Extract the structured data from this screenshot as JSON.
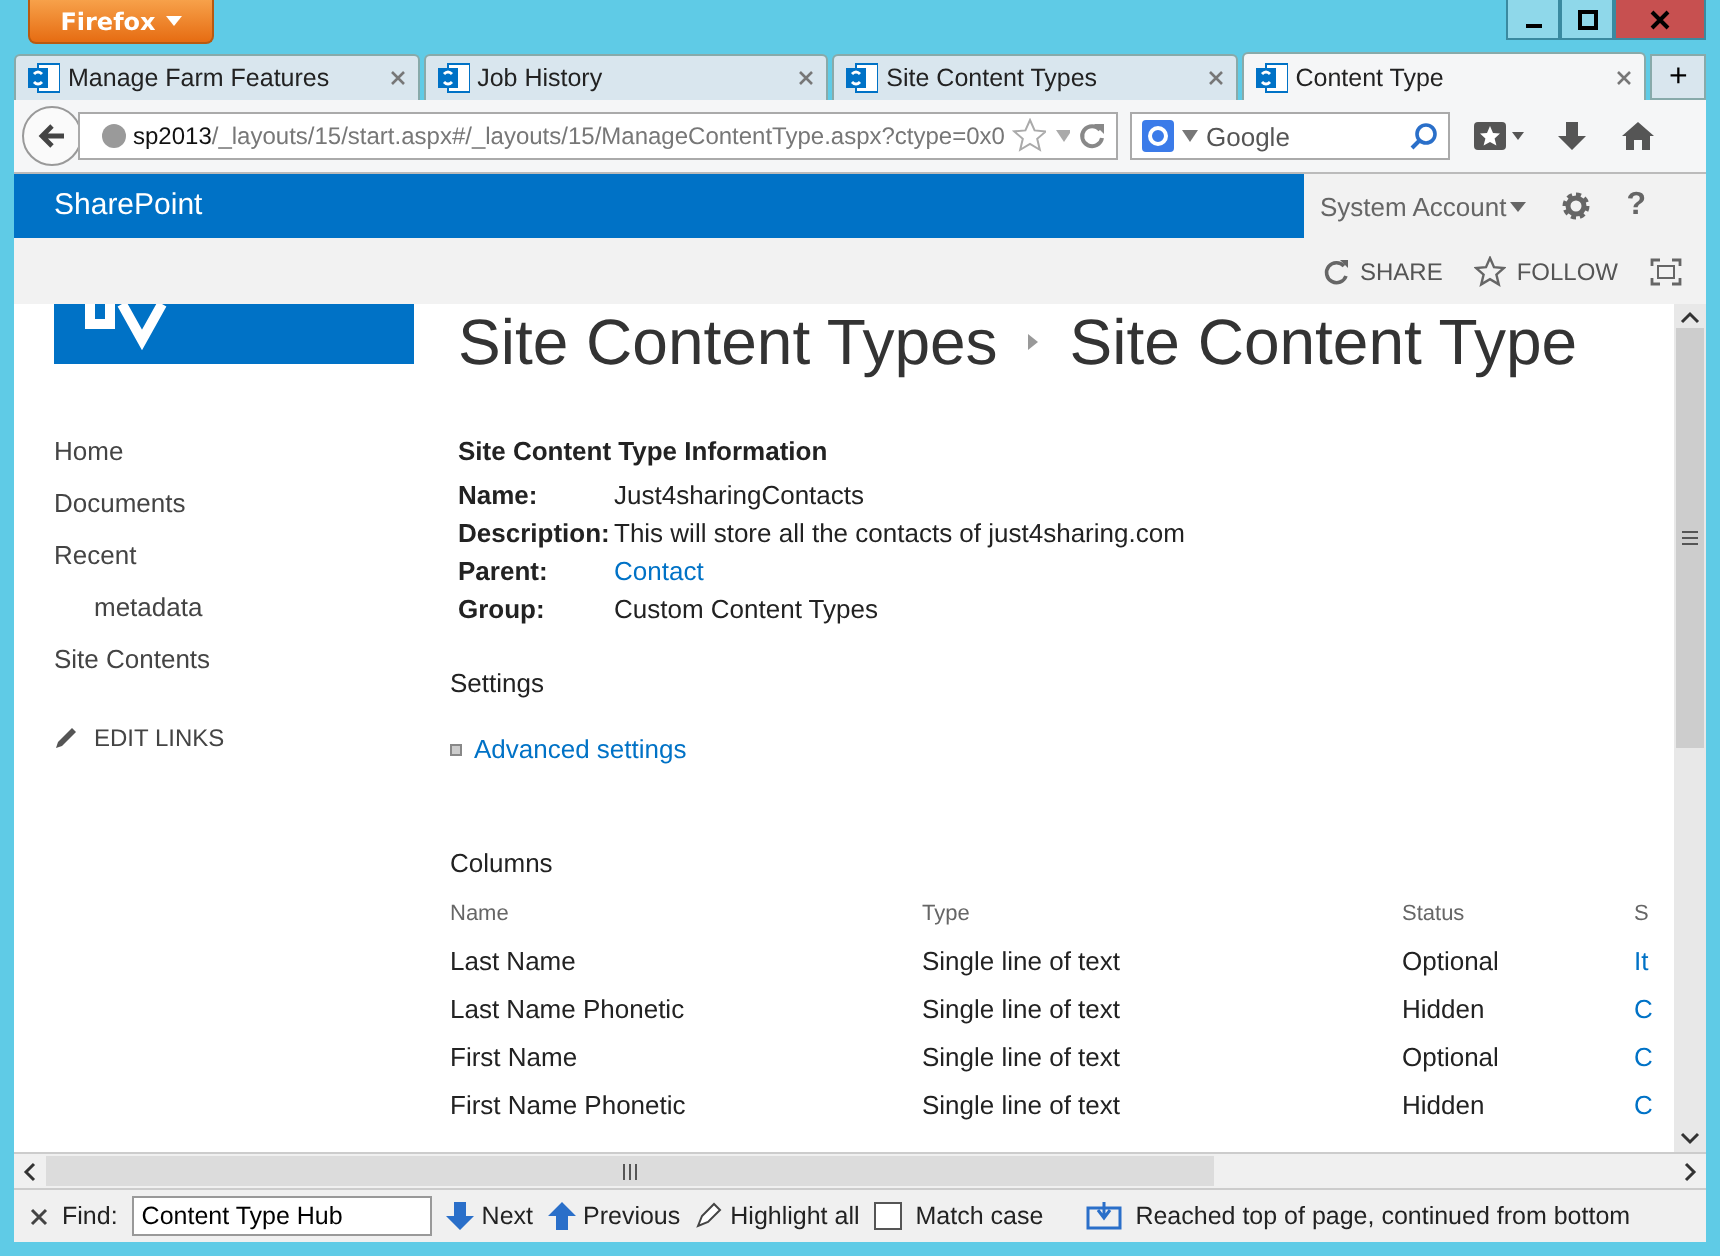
{
  "window": {
    "app_button": "Firefox"
  },
  "tabs": [
    {
      "label": "Manage Farm Features",
      "selected": false
    },
    {
      "label": "Job History",
      "selected": false
    },
    {
      "label": "Site Content Types",
      "selected": false
    },
    {
      "label": "Content Type",
      "selected": true
    }
  ],
  "new_tab": "+",
  "address": {
    "host": "sp2013",
    "path": "/_layouts/15/start.aspx#/_layouts/15/ManageContentType.aspx?ctype=0x0"
  },
  "search": {
    "placeholder": "Google"
  },
  "suite_bar": {
    "brand": "SharePoint",
    "account": "System Account",
    "help": "?"
  },
  "actions": [
    {
      "label": "SHARE",
      "kind": "share"
    },
    {
      "label": "FOLLOW",
      "kind": "follow"
    }
  ],
  "breadcrumb": [
    "Site Content Types",
    "Site Content Type"
  ],
  "nav": [
    {
      "label": "Home"
    },
    {
      "label": "Documents"
    },
    {
      "label": "Recent",
      "children": [
        {
          "label": "metadata"
        }
      ]
    },
    {
      "label": "Site Contents"
    }
  ],
  "edit_links": "EDIT LINKS",
  "info": {
    "title": "Site Content Type Information",
    "fields": [
      {
        "label": "Name:",
        "value": "Just4sharingContacts",
        "link": false
      },
      {
        "label": "Description:",
        "value": "This will store all the contacts of just4sharing.com",
        "link": false
      },
      {
        "label": "Parent:",
        "value": "Contact",
        "link": true
      },
      {
        "label": "Group:",
        "value": "Custom Content Types",
        "link": false
      }
    ]
  },
  "settings": {
    "title": "Settings",
    "links": [
      "Advanced settings"
    ]
  },
  "columns": {
    "title": "Columns",
    "headers": [
      "Name",
      "Type",
      "Status",
      "S"
    ],
    "rows": [
      [
        "Last Name",
        "Single line of text",
        "Optional",
        "It"
      ],
      [
        "Last Name Phonetic",
        "Single line of text",
        "Hidden",
        "C"
      ],
      [
        "First Name",
        "Single line of text",
        "Optional",
        "C"
      ],
      [
        "First Name Phonetic",
        "Single line of text",
        "Hidden",
        "C"
      ]
    ]
  },
  "find_bar": {
    "label": "Find:",
    "value": "Content Type Hub",
    "next": "Next",
    "previous": "Previous",
    "highlight": "Highlight all",
    "match_case": {
      "label": "Match case",
      "checked": false
    },
    "status": "Reached top of page, continued from bottom"
  }
}
